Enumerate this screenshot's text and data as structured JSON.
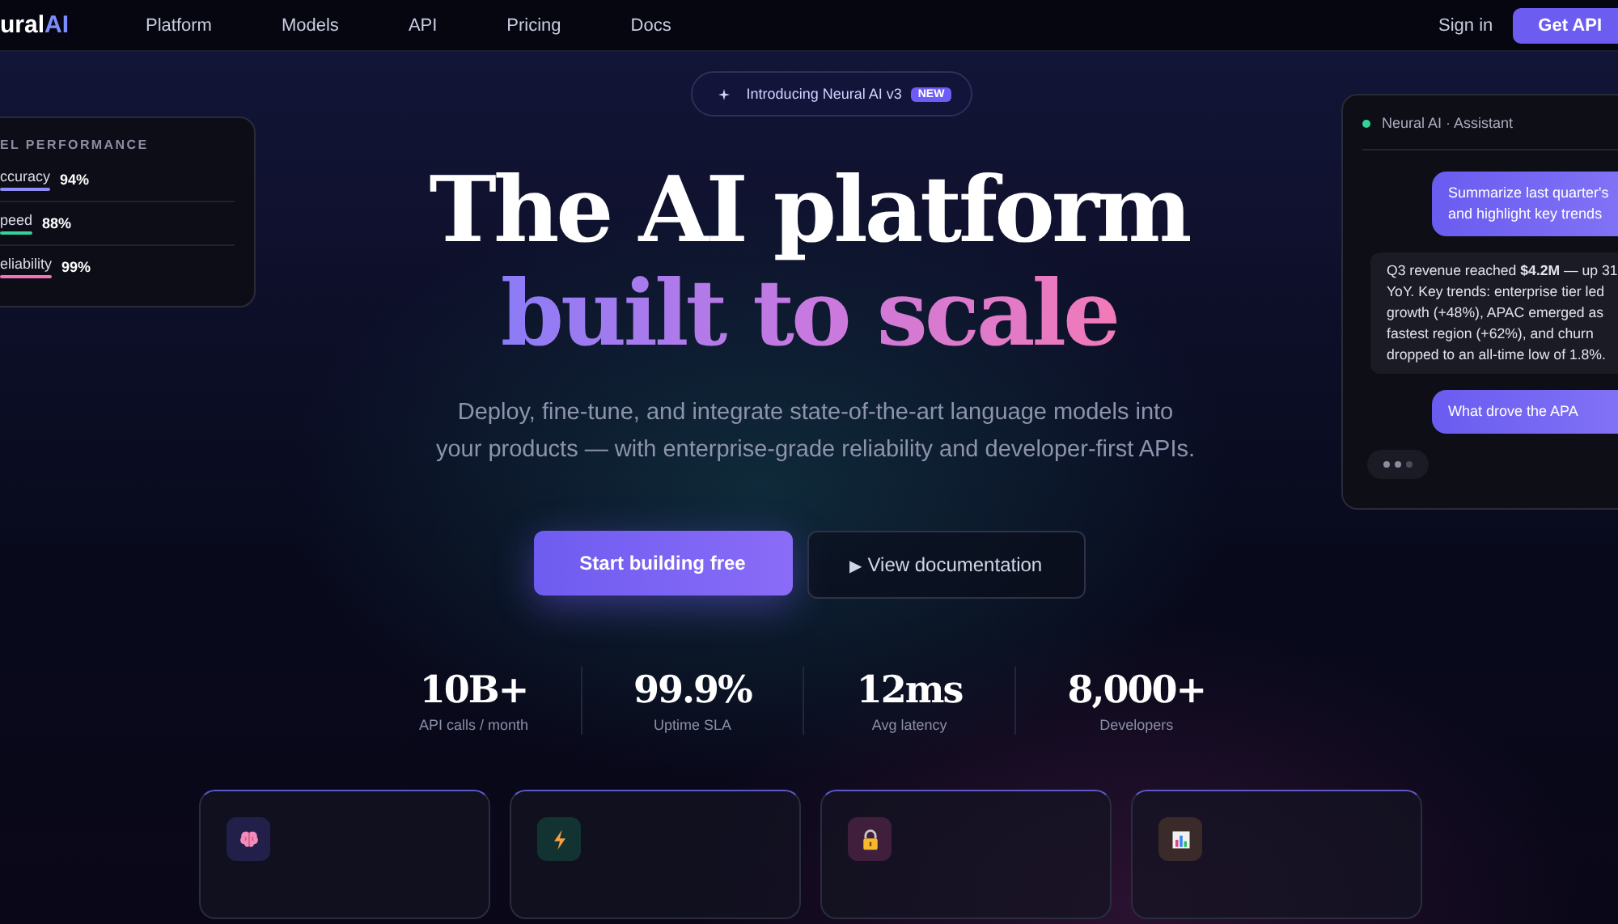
{
  "nav": {
    "logo_main": "ural",
    "logo_accent": "AI",
    "links": [
      "Platform",
      "Models",
      "API",
      "Pricing",
      "Docs"
    ],
    "sign_in": "Sign in",
    "cta": "Get API"
  },
  "badge": {
    "text": "Introducing Neural AI v3",
    "tag": "NEW"
  },
  "hero": {
    "title_line1": "The AI platform",
    "title_line2": "built to scale",
    "subtitle": "Deploy, fine-tune, and integrate state-of-the-art language models into your products — with enterprise-grade reliability and developer-first APIs.",
    "primary_button": "Start building free",
    "secondary_icon": "▶",
    "secondary_button": "View documentation"
  },
  "stats": [
    {
      "value": "10B+",
      "label": "API calls / month"
    },
    {
      "value": "99.9%",
      "label": "Uptime SLA"
    },
    {
      "value": "12ms",
      "label": "Avg latency"
    },
    {
      "value": "8,000+",
      "label": "Developers"
    }
  ],
  "performance_card": {
    "title": "EL PERFORMANCE",
    "metrics": [
      {
        "name": "ccuracy",
        "reading": "94%",
        "color": "#8b8cf6"
      },
      {
        "name": "peed",
        "reading": "88%",
        "color": "#34d399"
      },
      {
        "name": "eliability",
        "reading": "99%",
        "color": "#f472b6"
      }
    ]
  },
  "chat_card": {
    "title": "Neural AI · Assistant",
    "messages": [
      {
        "kind": "user",
        "lines": [
          "Summarize last quarter's",
          "and highlight key trends"
        ]
      },
      {
        "kind": "assistant",
        "lines": [
          "Q3 revenue reached **$4.2M** — up 31",
          "YoY. Key trends: enterprise tier led",
          "growth (+48%), APAC emerged as",
          "fastest region (+62%), and churn",
          "dropped to an all-time low of 1.8%."
        ]
      },
      {
        "kind": "user",
        "lines": [
          "What drove the APA"
        ]
      },
      {
        "kind": "typing"
      }
    ]
  }
}
